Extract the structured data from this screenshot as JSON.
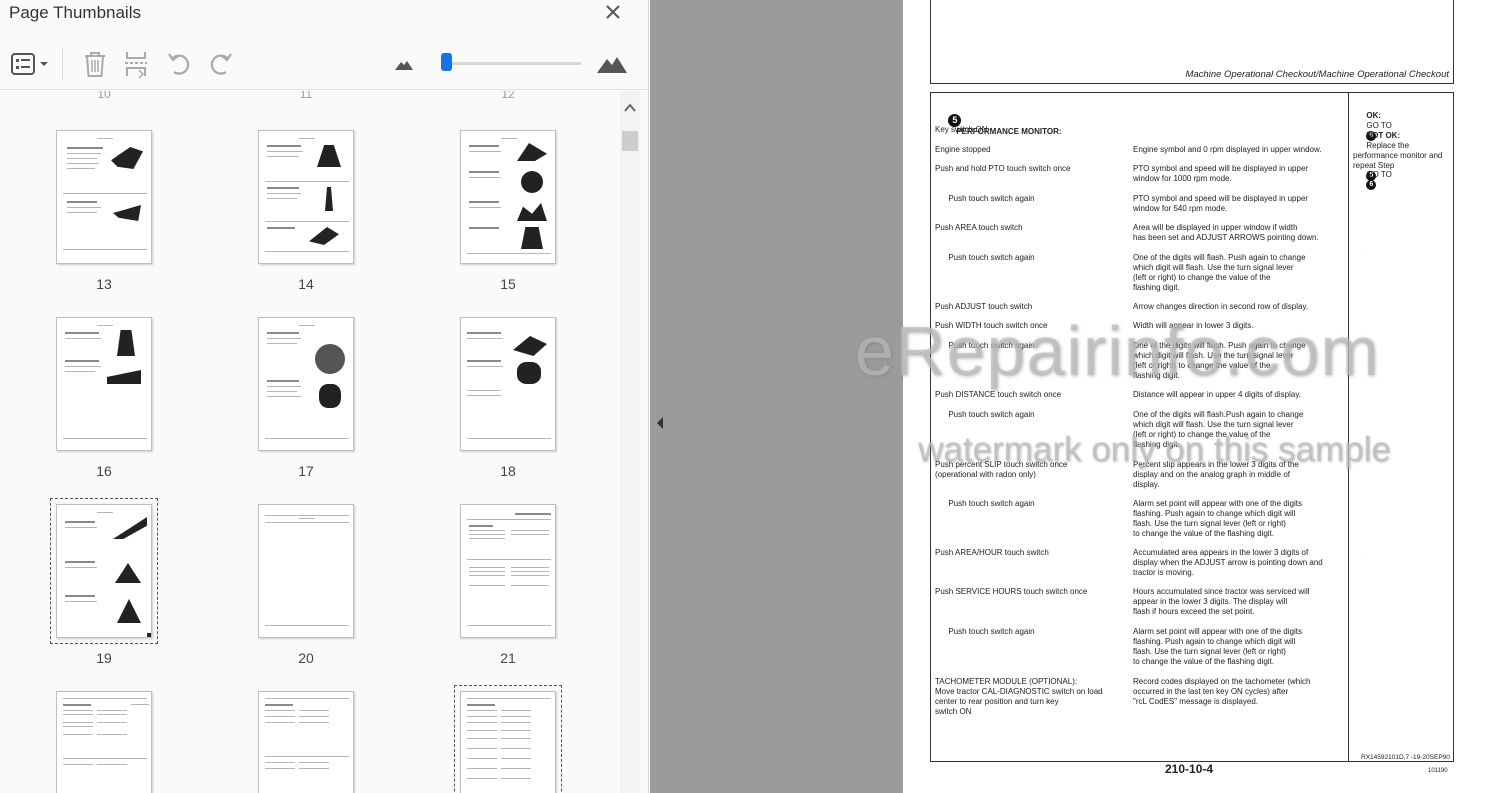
{
  "panel": {
    "title": "Page Thumbnails",
    "close_icon": "close-icon"
  },
  "toolbar": {
    "options_icon": "page-options-icon",
    "delete_icon": "trash-icon",
    "extract_icon": "extract-pages-icon",
    "undo_icon": "undo-icon",
    "redo_icon": "redo-icon",
    "zoom_out_icon": "small-mountain-icon",
    "zoom_in_icon": "large-mountain-icon",
    "zoom_level": 0.02
  },
  "thumbnails": {
    "partial_top": [
      "10",
      "11",
      "12"
    ],
    "pages": [
      "13",
      "14",
      "15",
      "16",
      "17",
      "18",
      "19",
      "20",
      "21"
    ],
    "selected": "19"
  },
  "doc": {
    "header": "Machine Operational Checkout/Machine Operational Checkout",
    "step_num": "5",
    "section_title": "PERFORMANCE MONITOR:",
    "rows": [
      {
        "l": "Key switch ON",
        "r": ""
      },
      {
        "l": "Engine stopped",
        "r": "Engine symbol and 0 rpm displayed in upper window."
      },
      {
        "l": "Push and hold PTO touch switch once",
        "r": "PTO symbol and speed will be displayed in upper\nwindow for 1000 rpm mode."
      },
      {
        "l": "      Push touch switch again",
        "r": "PTO symbol and speed will be displayed in upper\nwindow for 540 rpm mode."
      },
      {
        "l": "Push AREA touch switch",
        "r": "Area will be displayed in upper window if width\nhas been set and ADJUST ARROWS pointing down."
      },
      {
        "l": "      Push touch switch again",
        "r": "One of the digits will flash. Push again to change\nwhich digit will flash. Use the turn signal lever\n(left or right) to change the value of the\nflashing digit."
      },
      {
        "l": "Push ADJUST touch switch",
        "r": "Arrow changes direction in second row of display."
      },
      {
        "l": "Push WIDTH touch switch once",
        "r": "Width will appear in lower 3 digits."
      },
      {
        "l": "      Push touch switch again",
        "r": "One of the digits will flash. Push again to change\nwhich digit will flash. Use the turn signal lever\n(left or right) to change the value of the\nflashing digit."
      },
      {
        "l": "Push DISTANCE touch switch once",
        "r": "Distance will appear in upper 4 digits of display."
      },
      {
        "l": "      Push touch switch again",
        "r": "One of the digits will flash.Push again to change\nwhich digit will flash. Use the turn signal lever\n(left or right) to change the value of the\nflashing digit."
      },
      {
        "l": "Push percent SLIP touch switch once\n(operational with radon only)",
        "r": "Percent slip appears in the lower 3 digits of the\ndisplay and on the analog graph in middle of\ndisplay."
      },
      {
        "l": "      Push touch switch again",
        "r": "Alarm set point will appear with one of the digits\nflashing. Push again to change which digit will\nflash. Use the turn signal lever (left or right)\nto change the value of the flashing digit."
      },
      {
        "l": "Push AREA/HOUR touch switch",
        "r": "Accumulated area appears in the lower 3 digits of\ndisplay when the ADJUST arrow is pointing down and\ntractor is moving."
      },
      {
        "l": "Push SERVICE HOURS touch switch once",
        "r": "Hours accumulated since tractor was serviced will\nappear in the lower 3 digits. The display will\nflash if hours exceed the set point."
      },
      {
        "l": "      Push touch switch again",
        "r": "Alarm set point will appear with one of the digits\nflashing. Push again to change which digit will\nflash. Use the turn signal lever (left or right)\nto change the value of the flashing digit."
      },
      {
        "l": "TACHOMETER MODULE (OPTIONAL):\nMove tractor CAL-DIAGNOSTIC switch on load\ncenter to rear position and turn key\nswitch ON",
        "r": "Record codes displayed on the tachometer (which\noccurred in the last ten key ON cycles) after\n\"rcL CodES\" message is displayed."
      }
    ],
    "ok_label": "OK:",
    "ok_text": "GO TO",
    "ok_step": "6",
    "notok_label": "NOT OK:",
    "notok_text": "Replace the\nperformance monitor and\nrepeat Step",
    "notok_step": "5",
    "goto_text": "GO TO",
    "goto_step": "6",
    "page_number": "210-10-4",
    "doc_code": "RX14592101D,7  -19-20SEP90",
    "small_code": "101190"
  },
  "watermark": {
    "line1": "eRepairinfo.com",
    "line2": "watermark only on this sample"
  },
  "colors": {
    "accent": "#1473e6",
    "gray_area": "#9b9b9b",
    "panel_bg": "#fafafa"
  }
}
